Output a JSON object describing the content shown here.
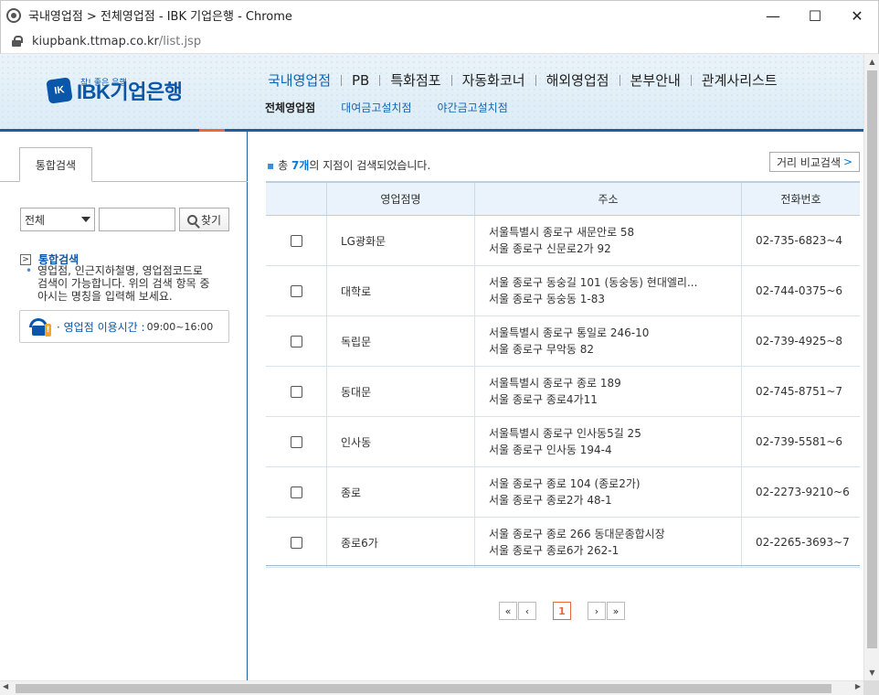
{
  "window": {
    "title": "국내영업점 > 전체영업점 - IBK 기업은행 - Chrome",
    "minimize": "—",
    "maximize": "☐",
    "close": "✕"
  },
  "address": {
    "domain": "kiupbank.ttmap.co.kr",
    "path": "/list.jsp"
  },
  "header": {
    "logo_mark": "IK",
    "logo_text": "IBK기업은행",
    "slogan": "참! 좋은 은행",
    "gnb": [
      "국내영업점",
      "PB",
      "특화점포",
      "자동화코너",
      "해외영업점",
      "본부안내",
      "관계사리스트"
    ],
    "lnb": [
      "전체영업점",
      "대여금고설치점",
      "야간금고설치점"
    ]
  },
  "left": {
    "tab": "통합검색",
    "select_value": "전체",
    "find_button": "찾기",
    "info_arrow": ">",
    "info_title": "통합검색",
    "info_desc_lines": [
      "영업점, 인근지하철명, 영업점코드로",
      "검색이 가능합니다. 위의 검색 항목 중",
      "아시는 명칭을 입력해 보세요."
    ],
    "hours_label": "· 영업점 이용시간 :",
    "hours_value": "09:00~16:00"
  },
  "result": {
    "prefix": "총",
    "count": "7개",
    "suffix": "의 지점이 검색되었습니다.",
    "compare_button": "거리 비교검색",
    "compare_chevron": ">"
  },
  "table": {
    "headers": [
      "",
      "영업점명",
      "주소",
      "전화번호"
    ],
    "rows": [
      {
        "name": "LG광화문",
        "addr1": "서울특별시 종로구 새문안로 58",
        "addr2": "서울 종로구 신문로2가 92",
        "phone": "02-735-6823~4"
      },
      {
        "name": "대학로",
        "addr1": "서울 종로구 동숭길 101 (동숭동) 현대엘리...",
        "addr2": "서울 종로구 동숭동 1-83",
        "phone": "02-744-0375~6"
      },
      {
        "name": "독립문",
        "addr1": "서울특별시 종로구 통일로 246-10",
        "addr2": "서울 종로구 무악동 82",
        "phone": "02-739-4925~8"
      },
      {
        "name": "동대문",
        "addr1": "서울특별시 종로구 종로 189",
        "addr2": "서울 종로구 종로4가11",
        "phone": "02-745-8751~7"
      },
      {
        "name": "인사동",
        "addr1": "서울특별시 종로구 인사동5길 25",
        "addr2": "서울 종로구 인사동 194-4",
        "phone": "02-739-5581~6"
      },
      {
        "name": "종로",
        "addr1": "서울 종로구 종로 104 (종로2가)",
        "addr2": "서울 종로구 종로2가 48-1",
        "phone": "02-2273-9210~6"
      },
      {
        "name": "종로6가",
        "addr1": "서울 종로구 종로 266 동대문종합시장",
        "addr2": "서울 종로구 종로6가 262-1",
        "phone": "02-2265-3693~7"
      }
    ]
  },
  "pager": {
    "first": "«",
    "prev": "‹",
    "current": "1",
    "next": "›",
    "last": "»"
  },
  "scroll": {
    "up": "▲",
    "down": "▼",
    "left": "◀",
    "right": "▶"
  },
  "colors": {
    "brand": "#0a56a8",
    "accent": "#e8683a",
    "link": "#1565b5"
  }
}
